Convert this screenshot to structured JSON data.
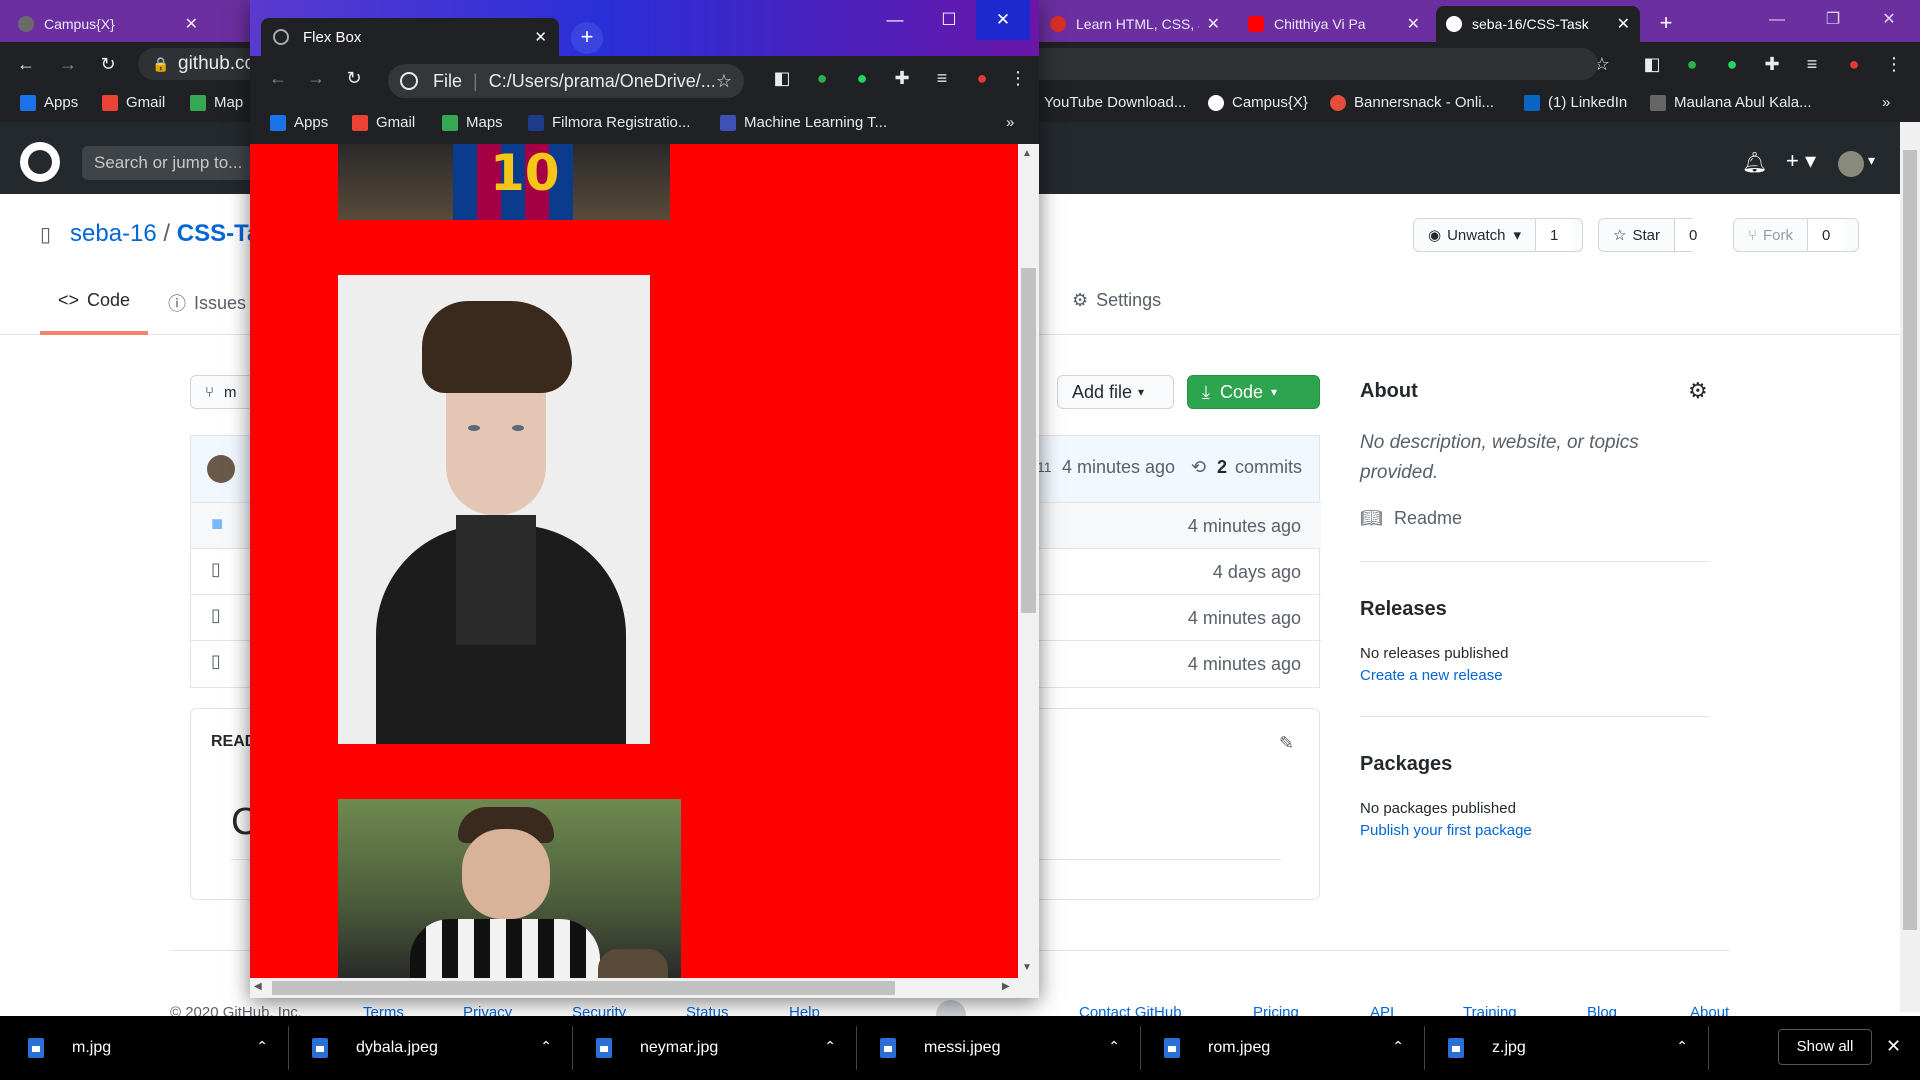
{
  "bg_tabs": [
    {
      "title": "Campus{X}",
      "color": "#6b6b6b"
    },
    {
      "title": "",
      "color": "#222"
    },
    {
      "title": "Learn HTML, CSS, J",
      "color": "#d93025"
    },
    {
      "title": "Chitthiya Vi Pa",
      "color": "#ff0000"
    },
    {
      "title": "seba-16/CSS-Task",
      "color": "#fff"
    }
  ],
  "bg_omnibox": "github.co",
  "bg_bookmarks": [
    "Apps",
    "Gmail",
    "Map",
    "YouTube Download...",
    "Campus{X}",
    "Bannersnack - Onli...",
    "(1) LinkedIn",
    "Maulana Abul Kala..."
  ],
  "github": {
    "search_placeholder": "Search or jump to...",
    "owner": "seba-16",
    "sep": "/",
    "repo": "CSS-Ta",
    "unwatch": "Unwatch",
    "unwatch_count": "1",
    "star": "Star",
    "star_count": "0",
    "fork": "Fork",
    "fork_count": "0",
    "tabs": {
      "code": "Code",
      "issues": "Issues",
      "settings": "Settings"
    },
    "branch_partial": "m",
    "add_file": "Add file",
    "code_btn": "Code",
    "latest_commit_hash_partial": "11",
    "latest_commit_time": "4 minutes ago",
    "commits_count": "2",
    "commits_label": "commits",
    "file_times": [
      "4 minutes ago",
      "4 days ago",
      "4 minutes ago",
      "4 minutes ago"
    ],
    "readme_partial": "READ",
    "readme_big_partial": "C",
    "about": {
      "title": "About",
      "description": "No description, website, or topics provided.",
      "readme": "Readme"
    },
    "releases": {
      "title": "Releases",
      "text": "No releases published",
      "link": "Create a new release"
    },
    "packages": {
      "title": "Packages",
      "text": "No packages published",
      "link": "Publish your first package"
    },
    "footer": [
      "© 2020 GitHub, Inc.",
      "Terms",
      "Privacy",
      "Security",
      "Status",
      "Help",
      "Contact GitHub",
      "Pricing",
      "API",
      "Training",
      "Blog",
      "About"
    ]
  },
  "popup": {
    "tab_title": "Flex Box",
    "omnibox_scheme": "File",
    "omnibox_url": "C:/Users/prama/OneDrive/...",
    "bookmarks": [
      "Apps",
      "Gmail",
      "Maps",
      "Filmora Registratio...",
      "Machine Learning T..."
    ],
    "more": "»",
    "background_color": "#ff0000"
  },
  "downloads": [
    {
      "name": "m.jpg"
    },
    {
      "name": "dybala.jpeg"
    },
    {
      "name": "neymar.jpg"
    },
    {
      "name": "messi.jpeg"
    },
    {
      "name": "rom.jpeg"
    },
    {
      "name": "z.jpg"
    }
  ],
  "show_all": "Show all"
}
